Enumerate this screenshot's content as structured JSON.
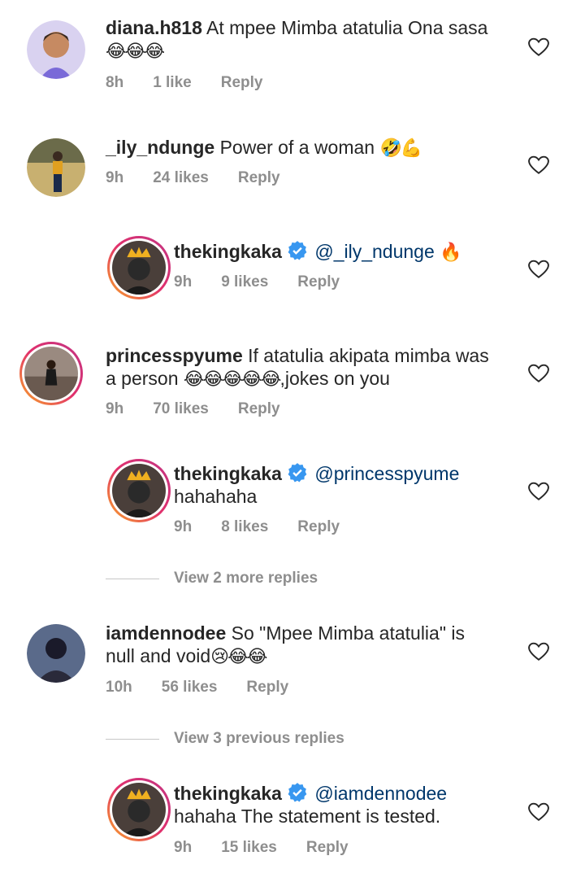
{
  "comments": [
    {
      "username": "diana.h818",
      "text": "At mpee Mimba atatulia Ona sasa",
      "emoji": "😂😂😂",
      "time": "8h",
      "likes": "1 like",
      "reply": "Reply"
    },
    {
      "username": "_ily_ndunge",
      "text": "Power of a woman",
      "emoji": "🤣💪",
      "time": "9h",
      "likes": "24 likes",
      "reply": "Reply"
    },
    {
      "username": "thekingkaka",
      "mention": "@_ily_ndunge",
      "emoji": "🔥",
      "time": "9h",
      "likes": "9 likes",
      "reply": "Reply"
    },
    {
      "username": "princesspyume",
      "text1": "If atatulia akipata mimba was",
      "text2": "a person",
      "emoji": "😂😂😂😂😂",
      "text3": ",jokes on you",
      "time": "9h",
      "likes": "70 likes",
      "reply": "Reply"
    },
    {
      "username": "thekingkaka",
      "mention": "@princesspyume",
      "text": "hahahaha",
      "time": "9h",
      "likes": "8 likes",
      "reply": "Reply"
    },
    {
      "username": "iamdennodee",
      "text1": "So \"Mpee Mimba atatulia\" is",
      "text2": "null and void",
      "emoji": "😢😂😂",
      "time": "10h",
      "likes": "56 likes",
      "reply": "Reply"
    },
    {
      "username": "thekingkaka",
      "mention": "@iamdennodee",
      "text": "hahaha The statement is tested.",
      "time": "9h",
      "likes": "15 likes",
      "reply": "Reply"
    }
  ],
  "view_more_1": "View 2 more replies",
  "view_more_2": "View 3 previous replies",
  "colors": {
    "mention": "#00376b",
    "meta": "#8e8e8e",
    "verified": "#3897f0"
  }
}
